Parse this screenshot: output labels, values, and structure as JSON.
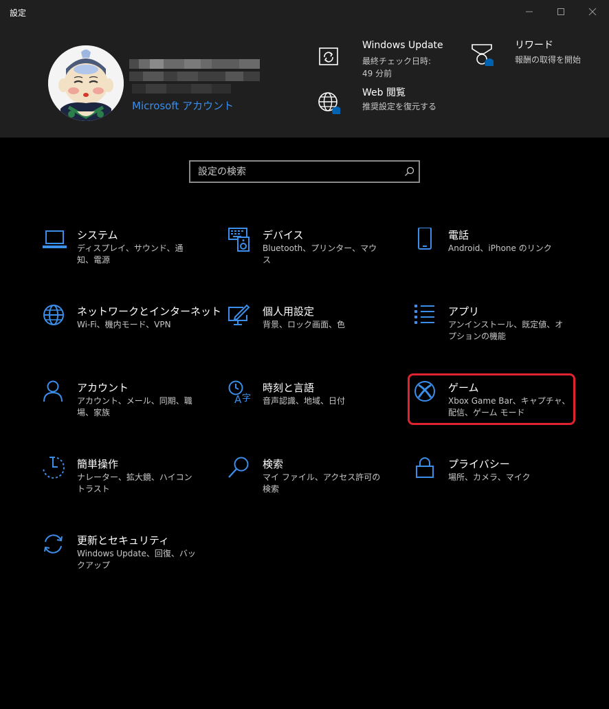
{
  "window": {
    "title": "設定"
  },
  "account": {
    "link_label": "Microsoft アカウント"
  },
  "header_items": [
    {
      "title": "Windows Update",
      "subtitle": "最終チェック日時: 49 分前",
      "icon": "windows-update-icon"
    },
    {
      "title": "リワード",
      "subtitle": "報酬の取得を開始",
      "icon": "rewards-medal-icon"
    },
    {
      "title": "Web 閲覧",
      "subtitle": "推奨設定を復元する",
      "icon": "web-globe-icon"
    }
  ],
  "search": {
    "placeholder": "設定の検索"
  },
  "tiles": [
    {
      "name": "システム",
      "desc": "ディスプレイ、サウンド、通知、電源",
      "icon": "laptop-icon"
    },
    {
      "name": "デバイス",
      "desc": "Bluetooth、プリンター、マウス",
      "icon": "keyboard-speaker-icon"
    },
    {
      "name": "電話",
      "desc": "Android、iPhone のリンク",
      "icon": "phone-icon"
    },
    {
      "name": "ネットワークとインターネット",
      "desc": "Wi-Fi、機内モード、VPN",
      "icon": "globe-icon"
    },
    {
      "name": "個人用設定",
      "desc": "背景、ロック画面、色",
      "icon": "pen-monitor-icon"
    },
    {
      "name": "アプリ",
      "desc": "アンインストール、既定値、オプションの機能",
      "icon": "app-list-icon"
    },
    {
      "name": "アカウント",
      "desc": "アカウント、メール、同期、職場、家族",
      "icon": "person-icon"
    },
    {
      "name": "時刻と言語",
      "desc": "音声認識、地域、日付",
      "icon": "time-language-icon"
    },
    {
      "name": "ゲーム",
      "desc": "Xbox Game Bar、キャプチャ、配信、ゲーム モード",
      "icon": "xbox-icon"
    },
    {
      "name": "簡単操作",
      "desc": "ナレーター、拡大鏡、ハイコントラスト",
      "icon": "ease-of-access-icon"
    },
    {
      "name": "検索",
      "desc": "マイ ファイル、アクセス許可の検索",
      "icon": "magnifier-icon"
    },
    {
      "name": "プライバシー",
      "desc": "場所、カメラ、マイク",
      "icon": "lock-icon"
    },
    {
      "name": "更新とセキュリティ",
      "desc": "Windows Update、回復、バックアップ",
      "icon": "sync-arrows-icon"
    }
  ],
  "colors": {
    "accent": "#3b8eea",
    "highlight": "#e0242f",
    "header_bg": "#1f1f1f",
    "background": "#000000"
  }
}
